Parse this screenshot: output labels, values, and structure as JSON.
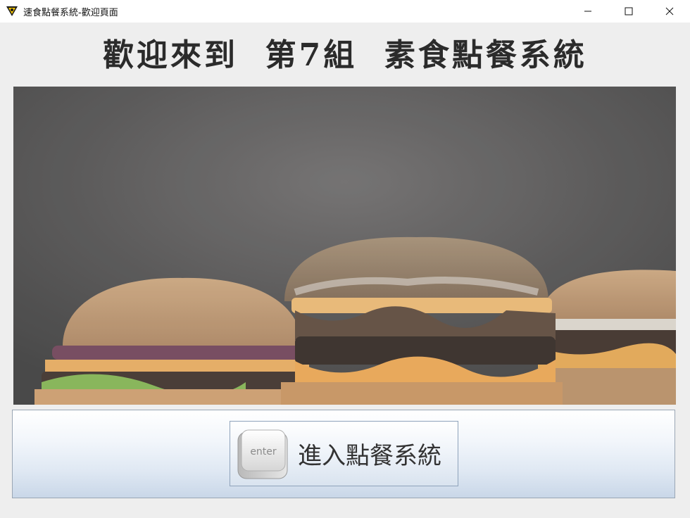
{
  "window": {
    "title": "速食點餐系統-歡迎頁面",
    "icons": [
      "app-logo-icon",
      "minimize-icon",
      "maximize-icon",
      "close-icon"
    ]
  },
  "heading": {
    "text": "歡迎來到  第7組  素食點餐系統"
  },
  "banner": {
    "subject": "burger-photo"
  },
  "enter_button": {
    "icon": "enter-key-icon",
    "key_text": "enter",
    "label": "進入點餐系統"
  },
  "colors": {
    "background": "#eeeeee",
    "heading": "#2b2b2b",
    "panel_top": "#ffffff",
    "panel_bottom": "#c9d7e8"
  }
}
